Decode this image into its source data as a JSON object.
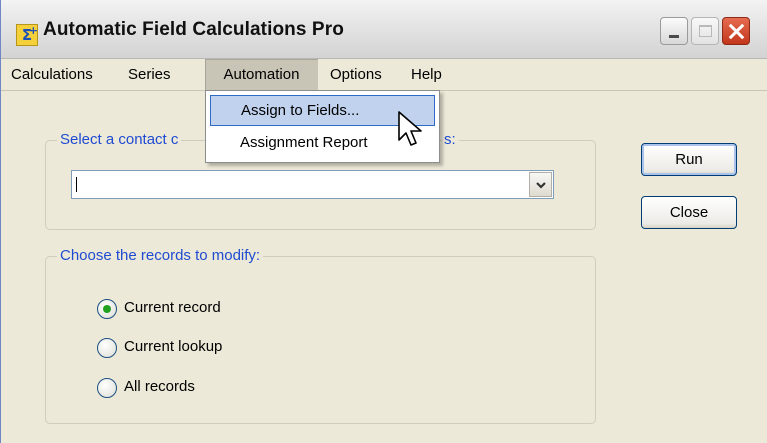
{
  "window": {
    "title": "Automatic Field Calculations Pro",
    "icon": "sigma-plus-icon"
  },
  "menubar": {
    "items": [
      {
        "label": "Calculations"
      },
      {
        "label": "Series"
      },
      {
        "label": "Automation",
        "active": true
      },
      {
        "label": "Options"
      },
      {
        "label": "Help"
      }
    ]
  },
  "automation_menu": {
    "items": [
      {
        "label": "Assign to Fields...",
        "highlighted": true
      },
      {
        "label": "Assignment Report"
      }
    ]
  },
  "contact_group": {
    "legend_visible_start": "Select a contact c",
    "legend_visible_end": "s:",
    "combo_value": ""
  },
  "buttons": {
    "run": "Run",
    "close": "Close"
  },
  "records_group": {
    "legend": "Choose the records to modify:",
    "options": [
      {
        "label": "Current record",
        "checked": true
      },
      {
        "label": "Current lookup",
        "checked": false
      },
      {
        "label": "All records",
        "checked": false
      }
    ]
  },
  "colors": {
    "accent_text": "#1f4bd2",
    "menu_highlight": "#c1d2ee",
    "radio_check": "#21a121"
  }
}
